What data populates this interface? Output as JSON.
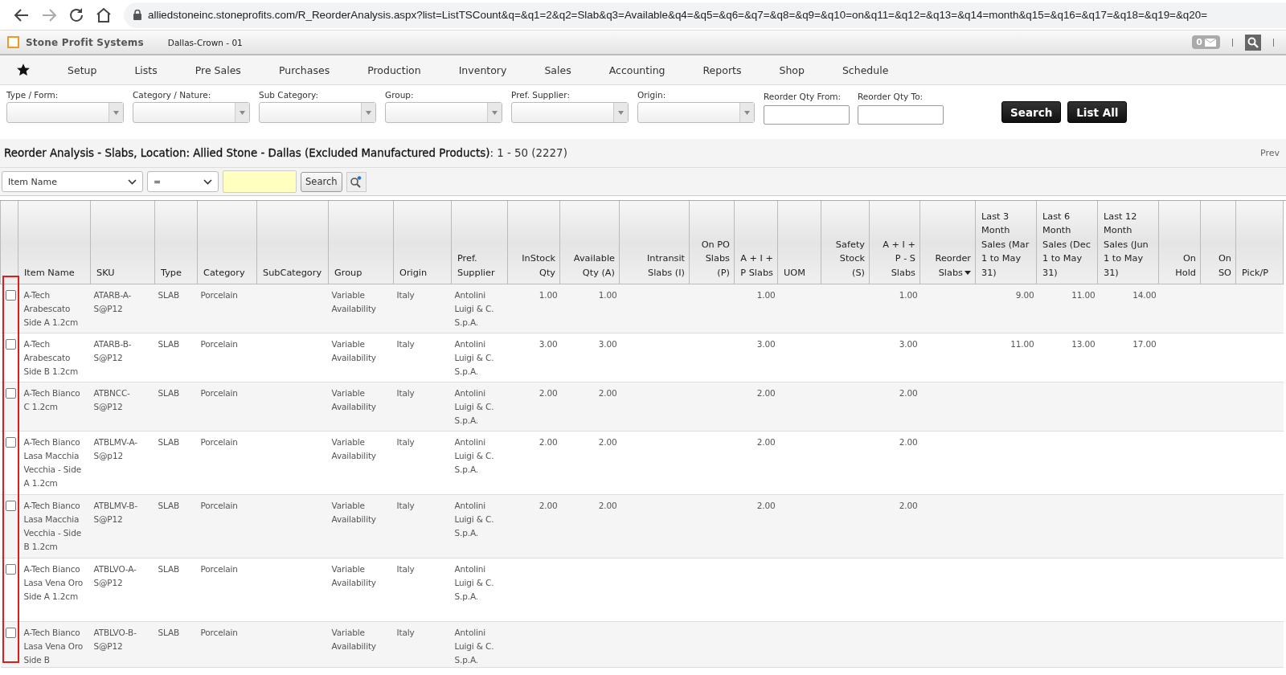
{
  "browser": {
    "url": "alliedstoneinc.stoneprofits.com/R_ReorderAnalysis.aspx?list=ListTSCount&q=&q1=2&q2=Slab&q3=Available&q4=&q5=&q6=&q7=&q8=&q9=&q10=on&q11=&q12=&q13=&q14=month&q15=&q16=&q17=&q18=&q19=&q20="
  },
  "app_header": {
    "brand": "Stone Profit Systems",
    "location": "Dallas-Crown - 01",
    "mail_count": "0"
  },
  "menu": {
    "items": [
      "Setup",
      "Lists",
      "Pre Sales",
      "Purchases",
      "Production",
      "Inventory",
      "Sales",
      "Accounting",
      "Reports",
      "Shop",
      "Schedule"
    ]
  },
  "filters": [
    {
      "label": "Type / Form:",
      "kind": "select"
    },
    {
      "label": "Category / Nature:",
      "kind": "select"
    },
    {
      "label": "Sub Category:",
      "kind": "select"
    },
    {
      "label": "Group:",
      "kind": "select"
    },
    {
      "label": "Pref. Supplier:",
      "kind": "select"
    },
    {
      "label": "Origin:",
      "kind": "select"
    },
    {
      "label": "Reorder Qty From:",
      "kind": "input"
    },
    {
      "label": "Reorder Qty To:",
      "kind": "input"
    }
  ],
  "filter_buttons": [
    "Search",
    "List All"
  ],
  "report": {
    "title": "**Reorder Analysis - Slabs, Location: Allied Stone - Dallas (Excluded Manufactured Products)**: 1 - 50 (2227)",
    "prev": "Prev"
  },
  "search_bar": {
    "field": "Item Name",
    "operator": "=",
    "button": "Search"
  },
  "table": {
    "columns": [
      {
        "label": "Item Name",
        "kind": "text",
        "sorted": false
      },
      {
        "label": "SKU",
        "kind": "text",
        "sorted": false
      },
      {
        "label": "Type",
        "kind": "text",
        "sorted": false
      },
      {
        "label": "Category",
        "kind": "text",
        "sorted": false
      },
      {
        "label": "SubCategory",
        "kind": "text",
        "sorted": false
      },
      {
        "label": "Group",
        "kind": "text",
        "sorted": false
      },
      {
        "label": "Origin",
        "kind": "text",
        "sorted": false
      },
      {
        "label": "Pref. Supplier",
        "kind": "text",
        "sorted": false
      },
      {
        "label": "InStock Qty",
        "kind": "number",
        "sorted": false
      },
      {
        "label": "Available Qty (A)",
        "kind": "number",
        "sorted": false
      },
      {
        "label": "Intransit Slabs (I)",
        "kind": "number",
        "sorted": false
      },
      {
        "label": "On PO Slabs (P)",
        "kind": "number",
        "sorted": false
      },
      {
        "label": "A + I + P Slabs",
        "kind": "number",
        "sorted": false
      },
      {
        "label": "UOM",
        "kind": "text",
        "sorted": false
      },
      {
        "label": "Safety Stock (S)",
        "kind": "number",
        "sorted": false
      },
      {
        "label": "A + I + P - S Slabs",
        "kind": "number",
        "sorted": false
      },
      {
        "label": "Reorder Slabs",
        "kind": "number",
        "sorted": true
      },
      {
        "label": "Last 3 Month Sales (Mar 1 to May 31)",
        "kind": "period",
        "sorted": false
      },
      {
        "label": "Last 6 Month Sales (Dec 1 to May 31)",
        "kind": "period",
        "sorted": false
      },
      {
        "label": "Last 12 Month Sales (Jun 1 to May 31)",
        "kind": "period",
        "sorted": false
      },
      {
        "label": "On Hold",
        "kind": "number",
        "sorted": false
      },
      {
        "label": "On SO",
        "kind": "number",
        "sorted": false
      },
      {
        "label": "Pick/P",
        "kind": "text",
        "sorted": false
      }
    ],
    "rows": [
      {
        "checked": false,
        "cells": [
          "A-Tech Arabescato Side A 1.2cm",
          "ATARB-A-S@P12",
          "SLAB",
          "Porcelain",
          null,
          "Variable Availability",
          "Italy",
          "Antolini Luigi & C. S.p.A.",
          "1.00",
          "1.00",
          null,
          null,
          "1.00",
          null,
          null,
          "1.00",
          null,
          "9.00",
          "11.00",
          "14.00",
          null,
          null,
          null
        ]
      },
      {
        "checked": false,
        "cells": [
          "A-Tech Arabescato Side B 1.2cm",
          "ATARB-B-S@P12",
          "SLAB",
          "Porcelain",
          null,
          "Variable Availability",
          "Italy",
          "Antolini Luigi & C. S.p.A.",
          "3.00",
          "3.00",
          null,
          null,
          "3.00",
          null,
          null,
          "3.00",
          null,
          "11.00",
          "13.00",
          "17.00",
          null,
          null,
          null
        ]
      },
      {
        "checked": false,
        "cells": [
          "A-Tech Bianco C 1.2cm",
          "ATBNCC-S@P12",
          "SLAB",
          "Porcelain",
          null,
          "Variable Availability",
          "Italy",
          "Antolini Luigi & C. S.p.A.",
          "2.00",
          "2.00",
          null,
          null,
          "2.00",
          null,
          null,
          "2.00",
          null,
          null,
          null,
          null,
          null,
          null,
          null
        ]
      },
      {
        "checked": false,
        "cells": [
          "A-Tech Bianco Lasa Macchia Vecchia - Side A 1.2cm",
          "ATBLMV-A-S@p12",
          "SLAB",
          "Porcelain",
          null,
          "Variable Availability",
          "Italy",
          "Antolini Luigi & C. S.p.A.",
          "2.00",
          "2.00",
          null,
          null,
          "2.00",
          null,
          null,
          "2.00",
          null,
          null,
          null,
          null,
          null,
          null,
          null
        ]
      },
      {
        "checked": false,
        "cells": [
          "A-Tech Bianco Lasa Macchia Vecchia - Side B 1.2cm",
          "ATBLMV-B-S@P12",
          "SLAB",
          "Porcelain",
          null,
          "Variable Availability",
          "Italy",
          "Antolini Luigi & C. S.p.A.",
          "2.00",
          "2.00",
          null,
          null,
          "2.00",
          null,
          null,
          "2.00",
          null,
          null,
          null,
          null,
          null,
          null,
          null
        ]
      },
      {
        "checked": false,
        "cells": [
          "A-Tech Bianco Lasa Vena Oro Side A 1.2cm",
          "ATBLVO-A-S@P12",
          "SLAB",
          "Porcelain",
          null,
          "Variable Availability",
          "Italy",
          "Antolini Luigi & C. S.p.A.",
          null,
          null,
          null,
          null,
          null,
          null,
          null,
          null,
          null,
          null,
          null,
          null,
          null,
          null,
          null
        ]
      },
      {
        "checked": false,
        "cells": [
          "A-Tech Bianco Lasa Vena Oro Side B",
          "ATBLVO-B-S@P12",
          "SLAB",
          "Porcelain",
          null,
          "Variable Availability",
          "Italy",
          "Antolini Luigi & C. S.p.A.",
          null,
          null,
          null,
          null,
          null,
          null,
          null,
          null,
          null,
          null,
          null,
          null,
          null,
          null,
          null
        ]
      }
    ]
  }
}
